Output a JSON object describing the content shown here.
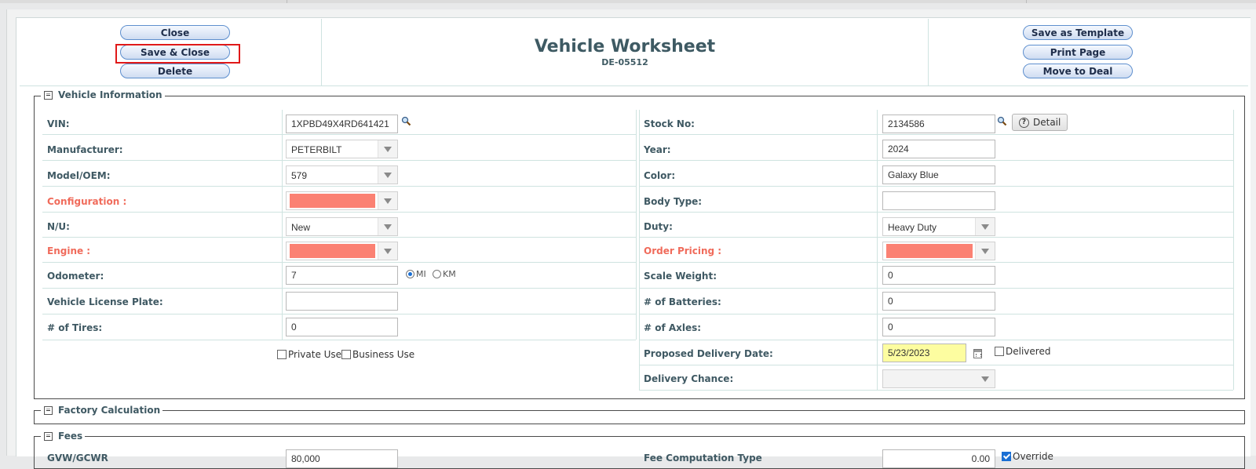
{
  "header": {
    "buttons_left": {
      "close": "Close",
      "save_close": "Save & Close",
      "delete": "Delete"
    },
    "title": "Vehicle Worksheet",
    "subtitle": "DE-05512",
    "buttons_right": {
      "save_template": "Save as Template",
      "print_page": "Print Page",
      "move_to_deal": "Move to Deal"
    }
  },
  "vehicle_info": {
    "legend": "Vehicle Information",
    "vin": {
      "label": "VIN:",
      "value": "1XPBD49X4RD641421"
    },
    "stock_no": {
      "label": "Stock No:",
      "value": "2134586"
    },
    "detail_button": "Detail",
    "manufacturer": {
      "label": "Manufacturer:",
      "value": "PETERBILT"
    },
    "year": {
      "label": "Year:",
      "value": "2024"
    },
    "model": {
      "label": "Model/OEM:",
      "value": "579"
    },
    "color": {
      "label": "Color:",
      "value": "Galaxy Blue"
    },
    "configuration": {
      "label": "Configuration :",
      "value": ""
    },
    "body_type": {
      "label": "Body Type:",
      "value": ""
    },
    "nu": {
      "label": "N/U:",
      "value": "New"
    },
    "duty": {
      "label": "Duty:",
      "value": "Heavy Duty"
    },
    "engine": {
      "label": "Engine :",
      "value": ""
    },
    "order_pricing": {
      "label": "Order Pricing :",
      "value": ""
    },
    "odometer": {
      "label": "Odometer:",
      "value": "7",
      "unit_mi": "MI",
      "unit_km": "KM",
      "selected_unit": "MI"
    },
    "scale_weight": {
      "label": "Scale Weight:",
      "value": "0"
    },
    "license_plate": {
      "label": "Vehicle License Plate:",
      "value": ""
    },
    "batteries": {
      "label": "# of Batteries:",
      "value": "0"
    },
    "tires": {
      "label": "# of Tires:",
      "value": "0"
    },
    "axles": {
      "label": "# of Axles:",
      "value": "0"
    },
    "private_use": {
      "label": "Private Use",
      "checked": false
    },
    "business_use": {
      "label": "Business Use",
      "checked": false
    },
    "proposed_delivery": {
      "label": "Proposed Delivery Date:",
      "value": "5/23/2023"
    },
    "delivered": {
      "label": "Delivered",
      "checked": false
    },
    "delivery_chance": {
      "label": "Delivery Chance:",
      "value": ""
    }
  },
  "factory": {
    "legend": "Factory Calculation"
  },
  "fees": {
    "legend": "Fees",
    "partial_label": "GVW/GCWR",
    "partial_value": "80,000",
    "partial_label2": "Fee Computation Type",
    "partial_value2": "0.00",
    "override": "Override"
  },
  "colors": {
    "required": "#f06b5b",
    "required_fill": "#fb8173",
    "date_highlight": "#fdfda0",
    "selected_red_box": "#e01919"
  }
}
